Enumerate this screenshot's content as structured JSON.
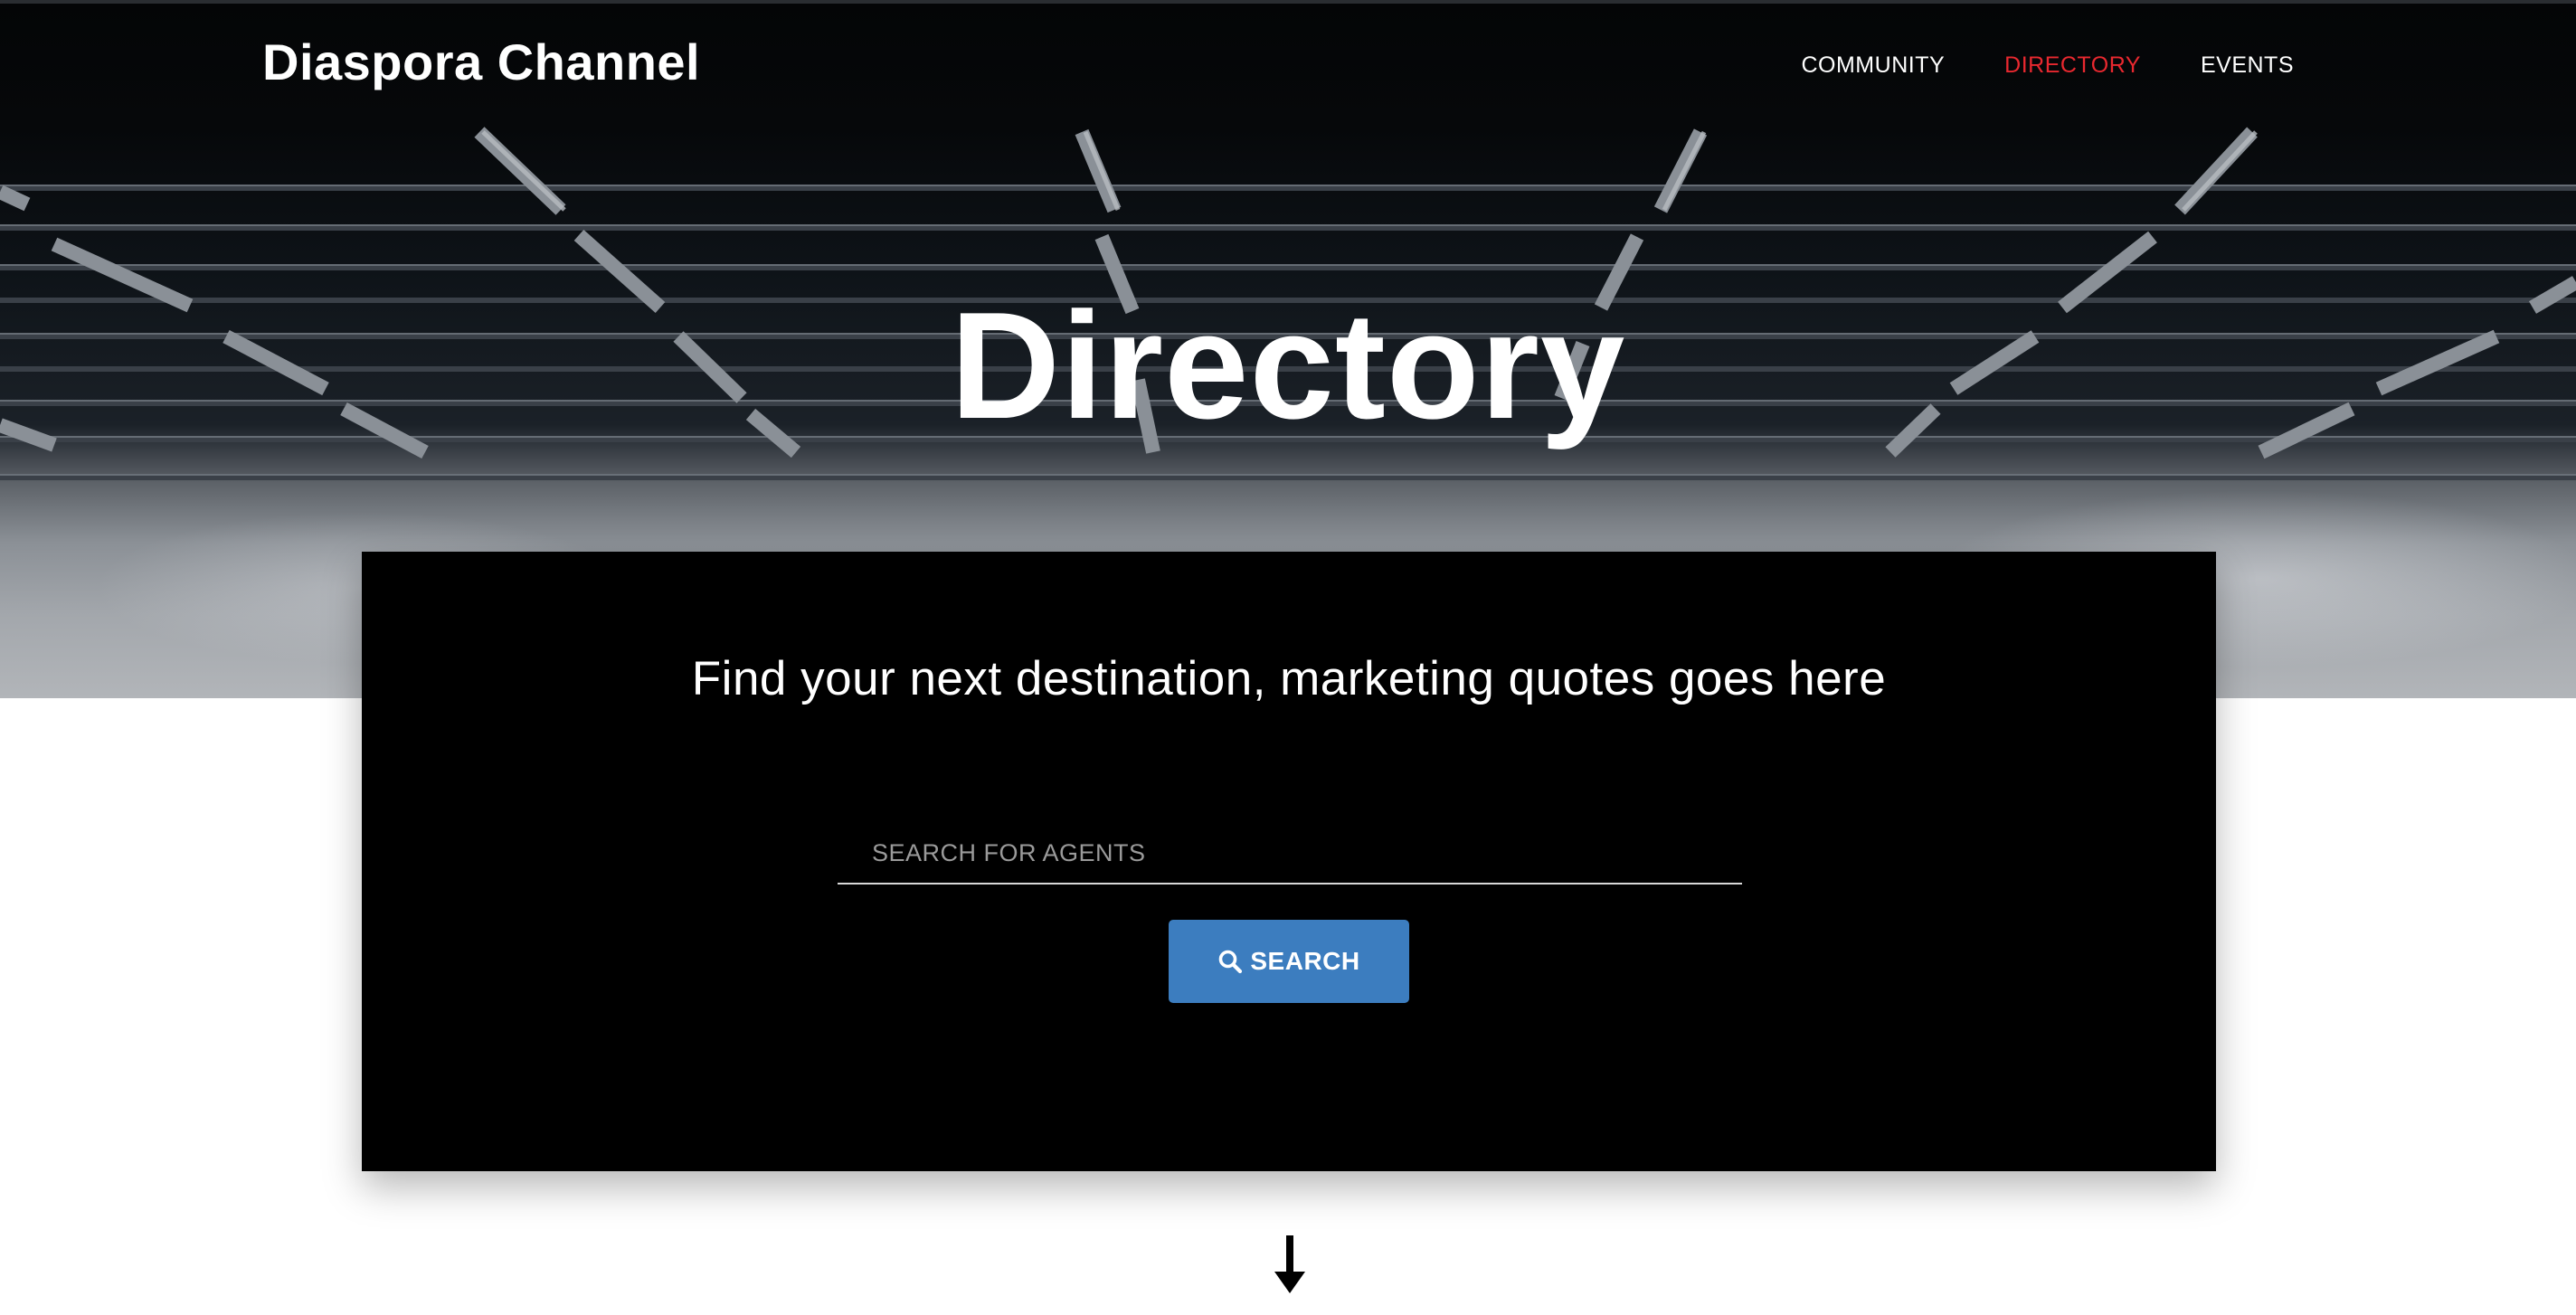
{
  "header": {
    "brand": "Diaspora Channel",
    "nav": [
      {
        "label": "COMMUNITY",
        "active": false
      },
      {
        "label": "DIRECTORY",
        "active": true
      },
      {
        "label": "EVENTS",
        "active": false
      }
    ]
  },
  "hero": {
    "title": "Directory"
  },
  "search_card": {
    "tagline": "Find your next destination, marketing quotes goes here",
    "search_placeholder": "SEARCH FOR AGENTS",
    "search_value": "",
    "search_button_label": "SEARCH",
    "search_button_icon": "search-icon"
  },
  "scroll_indicator": {
    "icon": "arrow-down-icon"
  },
  "colors": {
    "accent_active_nav": "#e8282f",
    "button": "#3c7dbf",
    "card_background": "#000000",
    "page_background": "#ffffff"
  }
}
